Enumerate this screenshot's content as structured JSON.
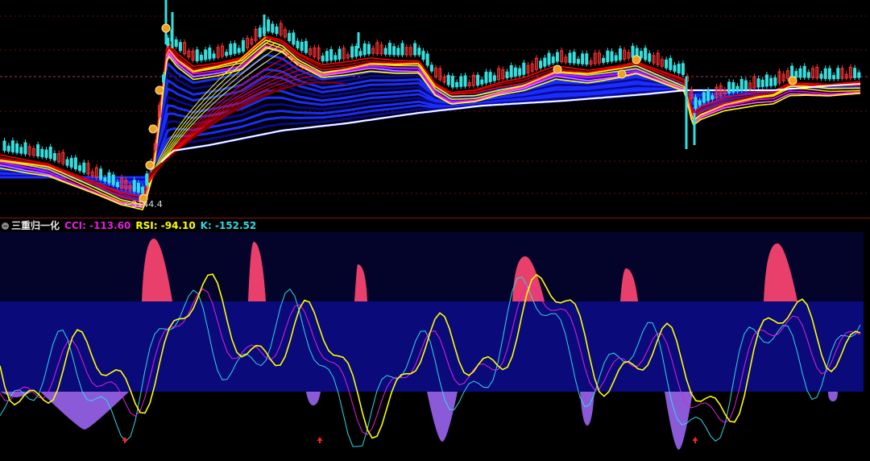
{
  "price_pane": {
    "low_marker": "←3144.4",
    "colors": {
      "up_candle": "#ff3333",
      "down_candle": "#33e0e0",
      "ribbon_red": "#ff0000",
      "ribbon_yellow": "#ffff00",
      "ribbon_magenta": "#ff00ff",
      "ribbon_blue": "#1a2cff",
      "long_ma": "#ffffff",
      "signal_icon": "#f0a020"
    }
  },
  "indicator": {
    "title": "三重归一化",
    "cci_label": "CCI:",
    "cci_value": "-113.60",
    "rsi_label": "RSI:",
    "rsi_value": "-94.10",
    "k_label": "K:",
    "k_value": "-152.52",
    "colors": {
      "cci": "#e020e0",
      "rsi": "#ffff00",
      "k": "#30d8e8",
      "band": "#0a0a7a",
      "upper_zone": "#04042a",
      "overbought_fill": "#e8406a",
      "oversold_fill": "#8a5ad8",
      "buy_arrow": "#ff2020"
    }
  }
}
